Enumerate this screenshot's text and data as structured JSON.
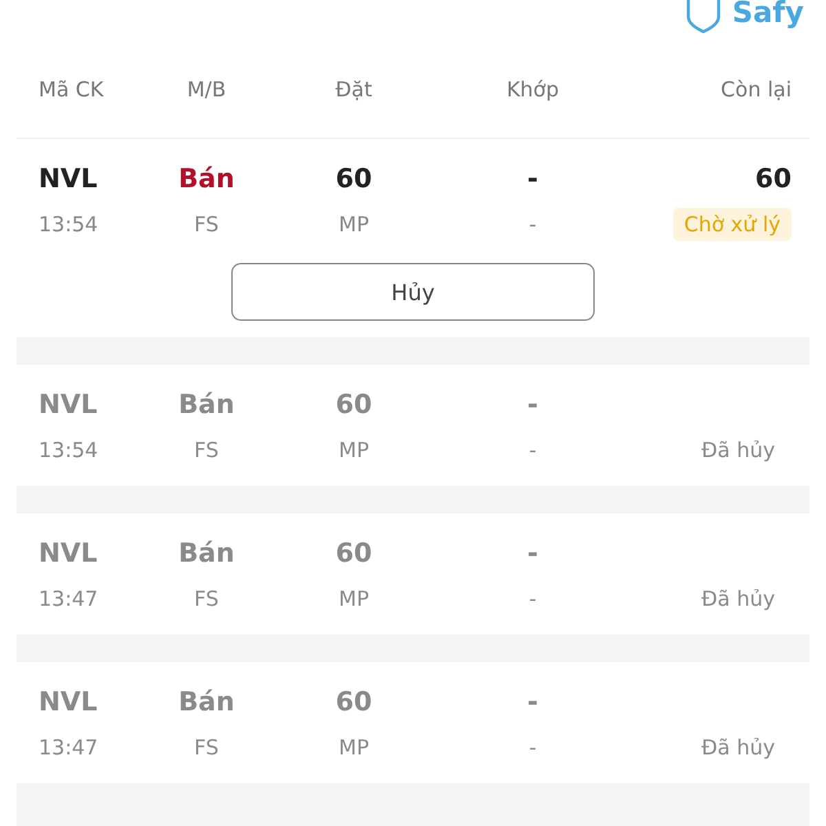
{
  "logo": {
    "text": "Safy"
  },
  "columns": [
    "Mã CK",
    "M/B",
    "Đặt",
    "Khớp",
    "Còn lại"
  ],
  "orders": [
    {
      "kind": "pending",
      "symbol": "NVL",
      "time": "13:54",
      "side": "Bán",
      "type": "FS",
      "quantity": "60",
      "price": "MP",
      "matched": "-",
      "matched_price": "-",
      "remaining": "60",
      "status_text": "Chờ xử lý",
      "cancel_button": "Hủy"
    },
    {
      "kind": "cancelled",
      "symbol": "NVL",
      "time": "13:54",
      "side": "Bán",
      "type": "FS",
      "quantity": "60",
      "price": "MP",
      "matched": "-",
      "matched_price": "-",
      "status_text": "Đã hủy"
    },
    {
      "kind": "cancelled",
      "symbol": "NVL",
      "time": "13:47",
      "side": "Bán",
      "type": "FS",
      "quantity": "60",
      "price": "MP",
      "matched": "-",
      "matched_price": "-",
      "status_text": "Đã hủy"
    },
    {
      "kind": "cancelled",
      "symbol": "NVL",
      "time": "13:47",
      "side": "Bán",
      "type": "FS",
      "quantity": "60",
      "price": "MP",
      "matched": "-",
      "matched_price": "-",
      "status_text": "Đã hủy"
    }
  ]
}
